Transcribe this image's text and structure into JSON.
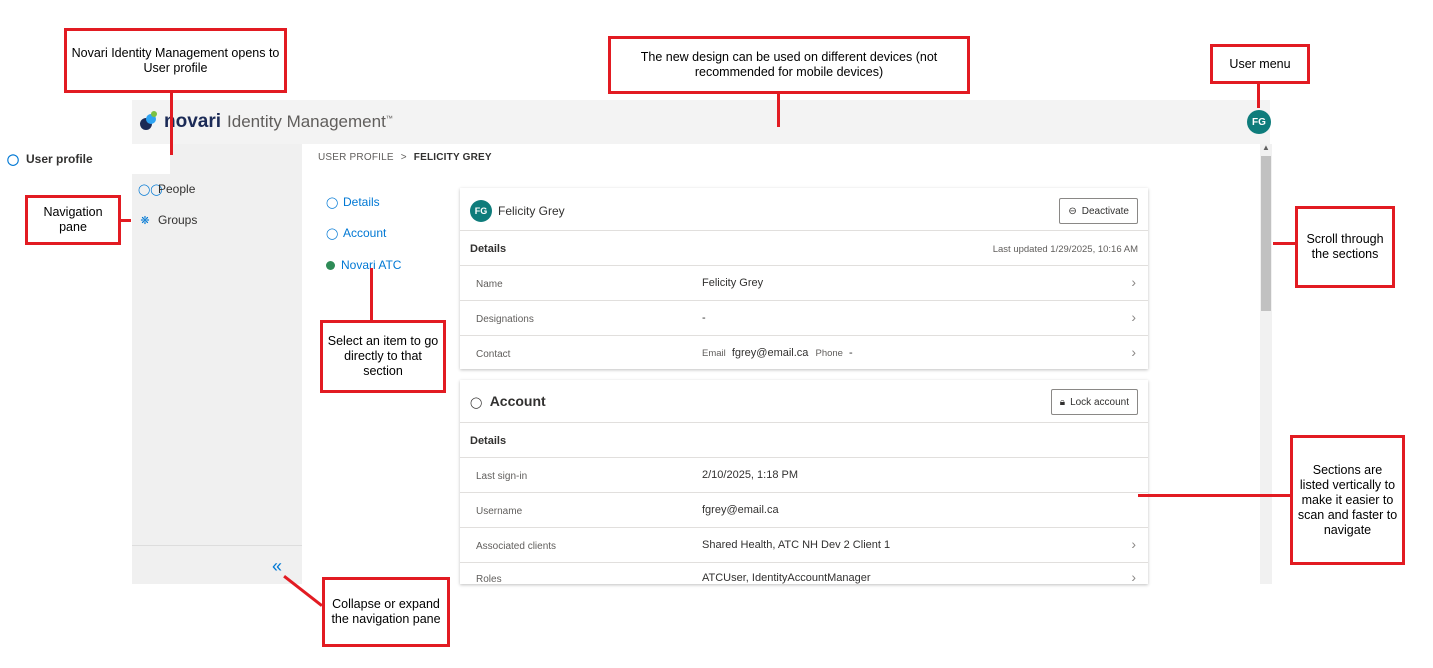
{
  "app": {
    "brand": "novari",
    "product": "Identity Management",
    "trademark": "™",
    "user_initials": "FG"
  },
  "nav": {
    "items": [
      {
        "label": "User profile",
        "icon": "person-icon"
      },
      {
        "label": "People",
        "icon": "people-icon"
      },
      {
        "label": "Groups",
        "icon": "groups-icon"
      }
    ],
    "collapse_icon": "«"
  },
  "breadcrumb": {
    "root": "USER PROFILE",
    "separator": ">",
    "current": "FELICITY GREY"
  },
  "jump_links": [
    {
      "label": "Details",
      "icon": "person-icon"
    },
    {
      "label": "Account",
      "icon": "account-icon"
    },
    {
      "label": "Novari ATC",
      "icon": "green-dot-icon"
    }
  ],
  "details_card": {
    "initials": "FG",
    "name": "Felicity Grey",
    "deactivate": "Deactivate",
    "section": "Details",
    "last_updated": "Last updated 1/29/2025, 10:16 AM",
    "rows": [
      {
        "label": "Name",
        "value": "Felicity Grey"
      },
      {
        "label": "Designations",
        "value": "-"
      },
      {
        "label": "Contact",
        "email_label": "Email",
        "email": "fgrey@email.ca",
        "phone_label": "Phone",
        "phone": "-"
      }
    ]
  },
  "account_card": {
    "title": "Account",
    "lock": "Lock account",
    "section": "Details",
    "rows": [
      {
        "label": "Last sign-in",
        "value": "2/10/2025, 1:18 PM"
      },
      {
        "label": "Username",
        "value": "fgrey@email.ca"
      },
      {
        "label": "Associated clients",
        "value": "Shared Health, ATC NH Dev 2 Client 1"
      },
      {
        "label": "Roles",
        "value": "ATCUser, IdentityAccountManager"
      }
    ]
  },
  "callouts": {
    "opens_to": "Novari Identity Management opens to User profile",
    "new_design": "The new design can be used on different devices (not recommended for mobile devices)",
    "user_menu": "User menu",
    "nav_pane": "Navigation pane",
    "scroll": "Scroll through the sections",
    "select_item": "Select an item to go directly to that section",
    "sections": "Sections are listed vertically to make it easier to scan and faster to navigate",
    "collapse": "Collapse or expand the navigation pane"
  },
  "colors": {
    "accent": "#0078d4",
    "avatar": "#0e7c7b",
    "callout_border": "#e21b22"
  }
}
